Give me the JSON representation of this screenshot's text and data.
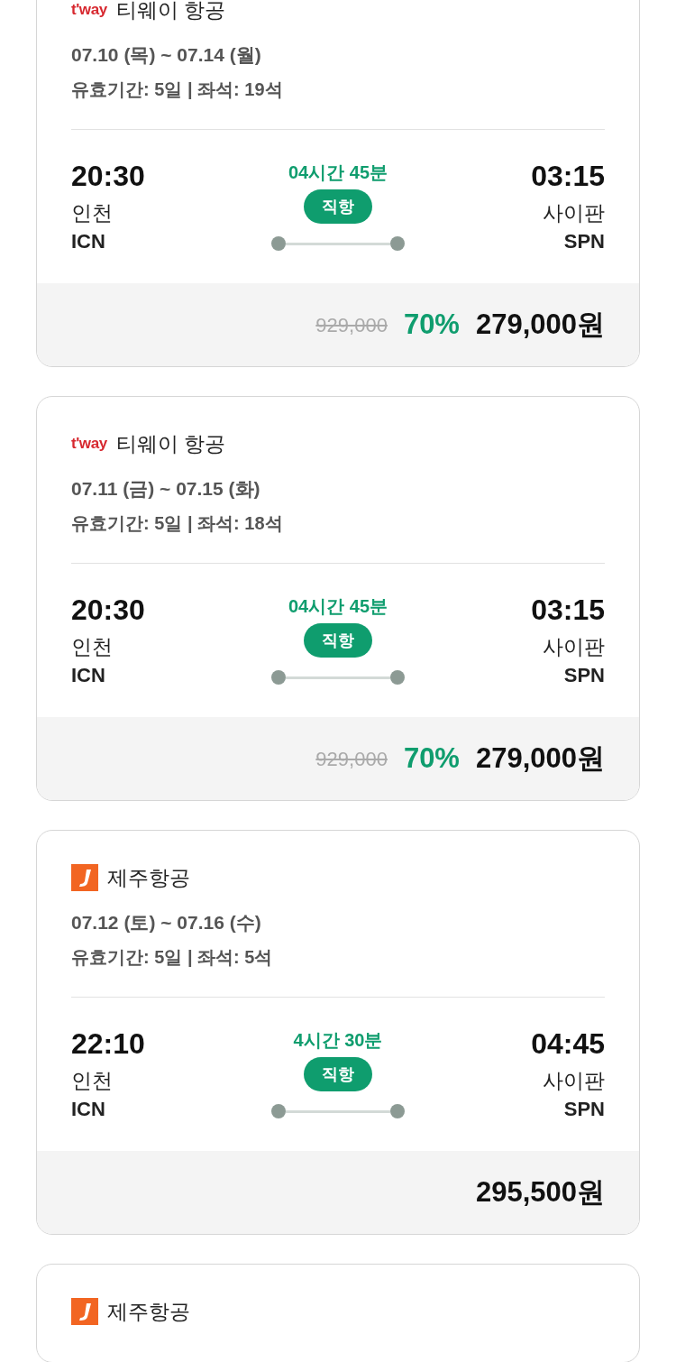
{
  "flights": [
    {
      "airline": {
        "kind": "tway",
        "logo_text": "t'way",
        "name": "티웨이 항공"
      },
      "dates": "07.10 (목) ~ 07.14 (월)",
      "validity": "유효기간: 5일 | 좌석: 19석",
      "departure": {
        "time": "20:30",
        "city": "인천",
        "code": "ICN"
      },
      "duration": "04시간 45분",
      "route_type": "직항",
      "arrival": {
        "time": "03:15",
        "city": "사이판",
        "code": "SPN"
      },
      "original_price": "929,000",
      "discount": "70%",
      "price": "279,000원"
    },
    {
      "airline": {
        "kind": "tway",
        "logo_text": "t'way",
        "name": "티웨이 항공"
      },
      "dates": "07.11 (금) ~ 07.15 (화)",
      "validity": "유효기간: 5일 | 좌석: 18석",
      "departure": {
        "time": "20:30",
        "city": "인천",
        "code": "ICN"
      },
      "duration": "04시간 45분",
      "route_type": "직항",
      "arrival": {
        "time": "03:15",
        "city": "사이판",
        "code": "SPN"
      },
      "original_price": "929,000",
      "discount": "70%",
      "price": "279,000원"
    },
    {
      "airline": {
        "kind": "jeju",
        "name": "제주항공"
      },
      "dates": "07.12 (토) ~ 07.16 (수)",
      "validity": "유효기간: 5일 | 좌석: 5석",
      "departure": {
        "time": "22:10",
        "city": "인천",
        "code": "ICN"
      },
      "duration": "4시간 30분",
      "route_type": "직항",
      "arrival": {
        "time": "04:45",
        "city": "사이판",
        "code": "SPN"
      },
      "price": "295,500원"
    },
    {
      "airline": {
        "kind": "jeju",
        "name": "제주항공"
      }
    }
  ]
}
